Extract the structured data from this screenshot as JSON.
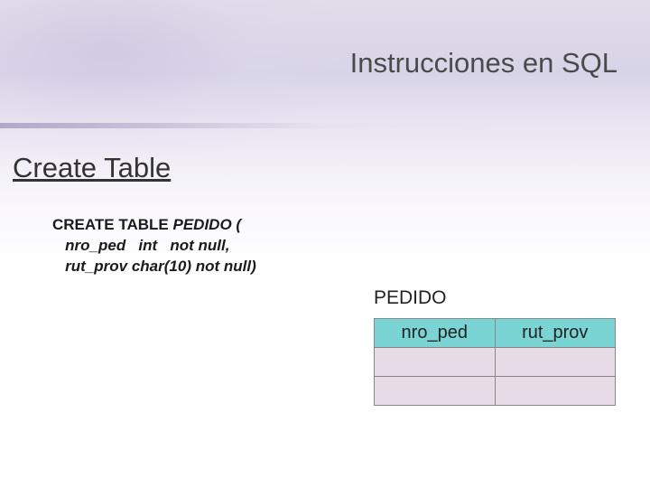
{
  "title": "Instrucciones en SQL",
  "subtitle": "Create Table",
  "code": {
    "line1a": "CREATE TABLE ",
    "line1b": "PEDIDO (",
    "line2": "   nro_ped   int   not null,",
    "line3": "   rut_prov char(10) not null)"
  },
  "table": {
    "label": "PEDIDO",
    "headers": [
      "nro_ped",
      "rut_prov"
    ],
    "rows": [
      [
        "",
        ""
      ],
      [
        "",
        ""
      ]
    ]
  }
}
